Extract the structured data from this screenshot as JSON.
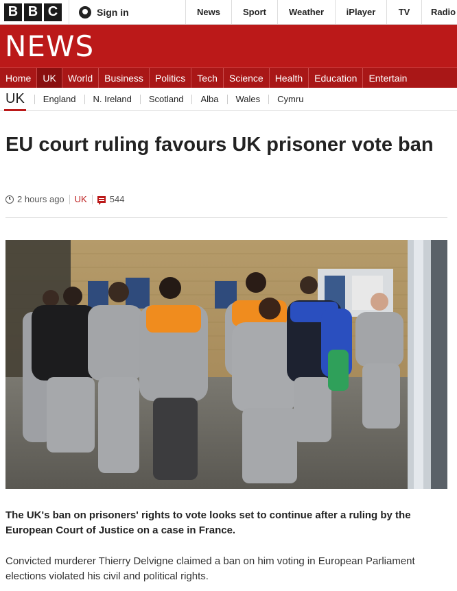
{
  "masthead": {
    "logo_letters": [
      "B",
      "B",
      "C"
    ],
    "signin_label": "Sign in",
    "nav": [
      "News",
      "Sport",
      "Weather",
      "iPlayer",
      "TV",
      "Radio"
    ]
  },
  "banner": {
    "wordmark": "NEWS"
  },
  "section_nav": {
    "items": [
      "Home",
      "UK",
      "World",
      "Business",
      "Politics",
      "Tech",
      "Science",
      "Health",
      "Education",
      "Entertain"
    ],
    "active": "UK"
  },
  "subnav": {
    "current": "UK",
    "items": [
      "England",
      "N. Ireland",
      "Scotland",
      "Alba",
      "Wales",
      "Cymru"
    ]
  },
  "article": {
    "headline": "EU court ruling favours UK prisoner vote ban",
    "timestamp": "2 hours ago",
    "section": "UK",
    "comment_count": "544",
    "intro": "The UK's ban on prisoners' rights to vote looks set to continue after a ruling by the European Court of Justice on a case in France.",
    "body": "Convicted murderer Thierry Delvigne claimed a ban on him voting in European Parliament elections violated his civil and political rights."
  },
  "colors": {
    "brand_red": "#bb1919",
    "nav_red": "#a91717",
    "nav_active": "#8a0f0f"
  },
  "icons": [
    "user-icon",
    "clock-icon",
    "comment-icon"
  ]
}
